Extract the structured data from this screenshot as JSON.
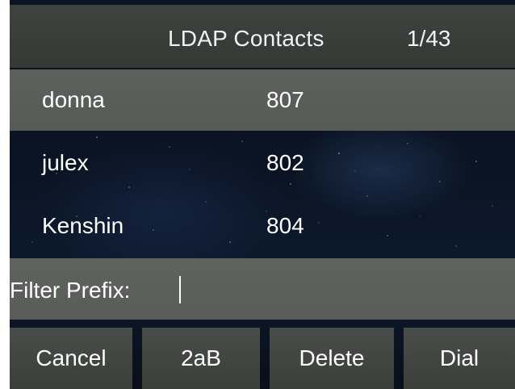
{
  "header": {
    "title": "LDAP Contacts",
    "page_indicator": "1/43"
  },
  "contacts": [
    {
      "name": "donna",
      "number": "807",
      "selected": true
    },
    {
      "name": "julex",
      "number": "802",
      "selected": false
    },
    {
      "name": "Kenshin",
      "number": "804",
      "selected": false
    }
  ],
  "filter": {
    "label": "Filter Prefix:",
    "value": ""
  },
  "softkeys": {
    "cancel": "Cancel",
    "input_mode": "2aB",
    "delete": "Delete",
    "dial": "Dial"
  },
  "colors": {
    "title_bar": "#3c403d",
    "selected_row": "#5b5e5b",
    "filter_bar": "#5d605d",
    "softkey": "#444744",
    "background": "#0b1424",
    "text": "#ffffff"
  }
}
